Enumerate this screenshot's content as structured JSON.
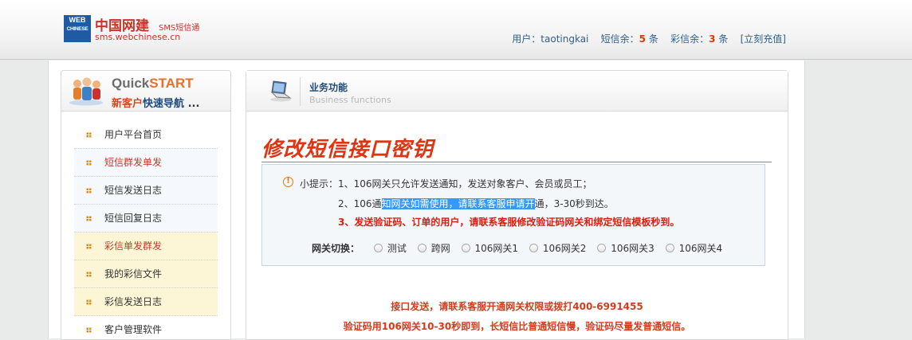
{
  "header": {
    "logo_box_line1": "WEB",
    "logo_box_line2": "CHINESE",
    "brand": "中国网建",
    "brand_sub": "SMS短信通",
    "url": "sms.webchinese.cn",
    "user_label": "用户：",
    "username": "taotingkai",
    "sms_label": "短信余：",
    "sms_count": "5",
    "mms_label": "彩信余：",
    "mms_count": "3",
    "unit": "条",
    "recharge": "[立刻充值]"
  },
  "sidebar": {
    "title_quick": "Quick",
    "title_start": "START",
    "sub_new": "新客户",
    "sub_nav": "快速导航",
    "sub_dots": "...",
    "items": [
      {
        "label": "用户平台首页"
      },
      {
        "label": "短信群发单发"
      },
      {
        "label": "短信发送日志"
      },
      {
        "label": "短信回复日志"
      },
      {
        "label": "彩信单发群发"
      },
      {
        "label": "我的彩信文件"
      },
      {
        "label": "彩信发送日志"
      },
      {
        "label": "客户管理软件"
      }
    ]
  },
  "panel": {
    "title": "业务功能",
    "title_en": "Business functions",
    "page_title": "修改短信接口密钥",
    "tip_prefix": "小提示：",
    "tip1": "1、106网关只允许发送通知，发送对象客户、会员或员工；",
    "tip2_a": "2、106通",
    "tip2_hl": "知网关如需使用，请联系客服申请开",
    "tip2_b": "通，3-30秒到达。",
    "tip3": "3、发送验证码、订单的用户，请联系客服修改验证码网关和绑定短信模板秒到。",
    "gateway_label": "网关切换：",
    "gateways": [
      "测试",
      "跨网",
      "106网关1",
      "106网关2",
      "106网关3",
      "106网关4"
    ],
    "notice1": "接口发送，请联系客服开通网关权限或拨打400-6991455",
    "notice2": "验证码用106网关10-30秒即到，长短信比普通短信慢，验证码尽量发普通短信。"
  }
}
